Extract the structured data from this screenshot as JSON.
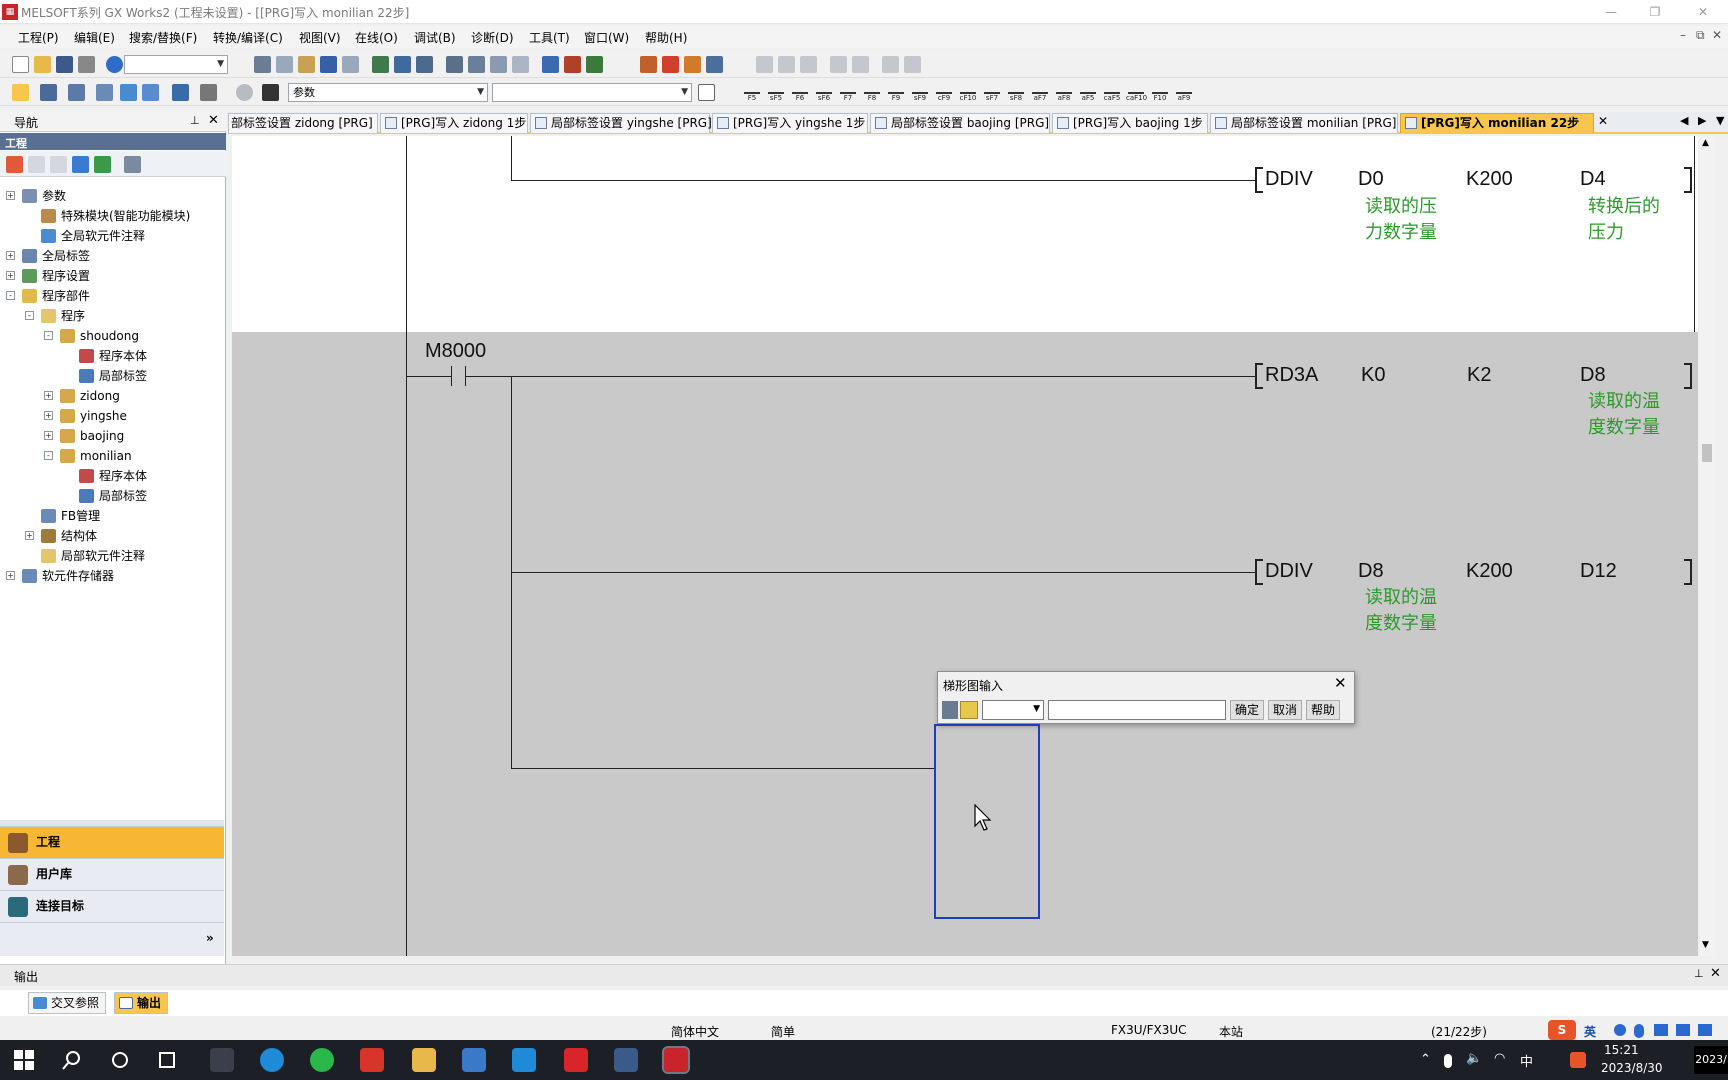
{
  "window": {
    "title": "MELSOFT系列 GX Works2 (工程未设置) - [[PRG]写入 monilian 22步]",
    "controls": {
      "minimize": "—",
      "restore": "❐",
      "close": "✕"
    },
    "mdi_controls": {
      "minimize": "–",
      "restore": "⧉",
      "close": "✕"
    }
  },
  "menu": [
    "工程(P)",
    "编辑(E)",
    "搜索/替换(F)",
    "转换/编译(C)",
    "视图(V)",
    "在线(O)",
    "调试(B)",
    "诊断(D)",
    "工具(T)",
    "窗口(W)",
    "帮助(H)"
  ],
  "toolbar": {
    "combo_top": "",
    "combo_param": "参数",
    "fkeys": [
      "F5",
      "sF5",
      "F6",
      "sF6",
      "F7",
      "F8",
      "F9",
      "sF9",
      "cF9",
      "cF10",
      "sF7",
      "sF8",
      "aF7",
      "aF8",
      "aF5",
      "caF5",
      "caF10",
      "F10",
      "aF9"
    ]
  },
  "nav": {
    "header": "导航",
    "subheader": "工程",
    "tree": [
      {
        "label": "参数",
        "icon": "param-icon",
        "color": "#7a8fb2"
      },
      {
        "label": "特殊模块(智能功能模块)",
        "icon": "module-icon",
        "color": "#b98a4a"
      },
      {
        "label": "全局软元件注释",
        "icon": "comment-icon",
        "color": "#4a8ccf"
      },
      {
        "label": "全局标签",
        "icon": "label-icon",
        "color": "#6a86ae"
      },
      {
        "label": "程序设置",
        "icon": "settings-icon",
        "color": "#5c9a5c"
      },
      {
        "label": "程序部件",
        "icon": "folder-icon",
        "color": "#e3b84c"
      },
      {
        "label": "程序",
        "icon": "folder-icon",
        "color": "#e3c56c"
      },
      {
        "label": "shoudong",
        "icon": "program-icon",
        "color": "#d6a84c"
      },
      {
        "label": "程序本体",
        "icon": "ladder-icon",
        "color": "#c24a4a"
      },
      {
        "label": "局部标签",
        "icon": "label-icon",
        "color": "#4a7ab8"
      },
      {
        "label": "zidong",
        "icon": "program-icon",
        "color": "#d6a84c"
      },
      {
        "label": "yingshe",
        "icon": "program-icon",
        "color": "#d6a84c"
      },
      {
        "label": "baojing",
        "icon": "program-icon",
        "color": "#d6a84c"
      },
      {
        "label": "monilian",
        "icon": "program-icon",
        "color": "#d6a84c"
      },
      {
        "label": "程序本体",
        "icon": "ladder-icon",
        "color": "#c24a4a"
      },
      {
        "label": "局部标签",
        "icon": "label-icon",
        "color": "#4a7ab8"
      },
      {
        "label": "FB管理",
        "icon": "fb-icon",
        "color": "#6a8ab8"
      },
      {
        "label": "结构体",
        "icon": "struct-icon",
        "color": "#a07a3a"
      },
      {
        "label": "局部软元件注释",
        "icon": "folder-icon",
        "color": "#e3c56c"
      },
      {
        "label": "软元件存储器",
        "icon": "memory-icon",
        "color": "#6a8ab8"
      }
    ],
    "buttons": [
      {
        "label": "工程",
        "color": "#f7b733"
      },
      {
        "label": "用户库",
        "color": "#e8ecf2"
      },
      {
        "label": "连接目标",
        "color": "#e8ecf2"
      }
    ],
    "more": "»"
  },
  "tabs": [
    {
      "label": "部标签设置 zidong [PRG]"
    },
    {
      "label": "[PRG]写入 zidong 1步"
    },
    {
      "label": "局部标签设置 yingshe [PRG]"
    },
    {
      "label": "[PRG]写入 yingshe 1步"
    },
    {
      "label": "局部标签设置 baojing [PRG]"
    },
    {
      "label": "[PRG]写入 baojing 1步"
    },
    {
      "label": "局部标签设置 monilian [PRG]"
    },
    {
      "label": "[PRG]写入 monilian 22步"
    }
  ],
  "ladder": {
    "row0": {
      "op": "DDIV",
      "a": "D0",
      "b": "K200",
      "c": "D4",
      "comment_a": [
        "读取的压",
        "力数字量"
      ],
      "comment_c": [
        "转换后的",
        "压力"
      ]
    },
    "contact": "M8000",
    "row1": {
      "op": "RD3A",
      "a": "K0",
      "b": "K2",
      "c": "D8",
      "comment_c": [
        "读取的温",
        "度数字量"
      ]
    },
    "row2": {
      "op": "DDIV",
      "a": "D8",
      "b": "K200",
      "c": "D12",
      "comment_a": [
        "读取的温",
        "度数字量"
      ]
    }
  },
  "dialog": {
    "title": "梯形图输入",
    "input_value": "",
    "ok": "确定",
    "cancel": "取消",
    "help": "帮助"
  },
  "output": {
    "title": "输出",
    "tabs": [
      "交叉参照",
      "输出"
    ]
  },
  "status": {
    "language": "简体中文",
    "mode": "简单",
    "plc": "FX3U/FX3UC",
    "station": "本站",
    "steps": "(21/22步)"
  },
  "taskbar": {
    "time": "15:21",
    "date": "2023/8/30",
    "ime": "英",
    "lang": "中",
    "corner": "2023/"
  }
}
